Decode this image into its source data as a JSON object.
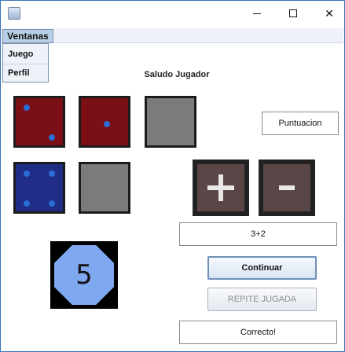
{
  "window": {
    "close_glyph": "✕"
  },
  "menu": {
    "ventanas_label": "Ventanas",
    "items": [
      {
        "label": "Juego"
      },
      {
        "label": "Perfil"
      }
    ]
  },
  "greeting": "Saludo Jugador",
  "dice": {
    "top_row": [
      {
        "value": 2,
        "color": "#7b0f16",
        "state": "rolled"
      },
      {
        "value": 1,
        "color": "#7b0f16",
        "state": "rolled"
      },
      {
        "value": null,
        "color": "#7b7b7b",
        "state": "empty"
      }
    ],
    "bottom_row": [
      {
        "value": 4,
        "color": "#1f2d87",
        "state": "rolled"
      },
      {
        "value": null,
        "color": "#7b7b7b",
        "state": "empty"
      }
    ],
    "pip_color": "#2a6ed3"
  },
  "score_field": "Puntuacion",
  "operations": {
    "plus_icon": "plus-icon",
    "minus_icon": "minus-icon"
  },
  "expression_field": "3+2",
  "result_die": {
    "value": "5",
    "color": "#7ea8f0"
  },
  "buttons": {
    "continue_label": "Continuar",
    "repeat_label": "REPITE JUGADA",
    "repeat_enabled": false
  },
  "feedback_field": "Correcto!",
  "colors": {
    "window_border": "#3a73b6",
    "button_border": "#7a93b3"
  }
}
